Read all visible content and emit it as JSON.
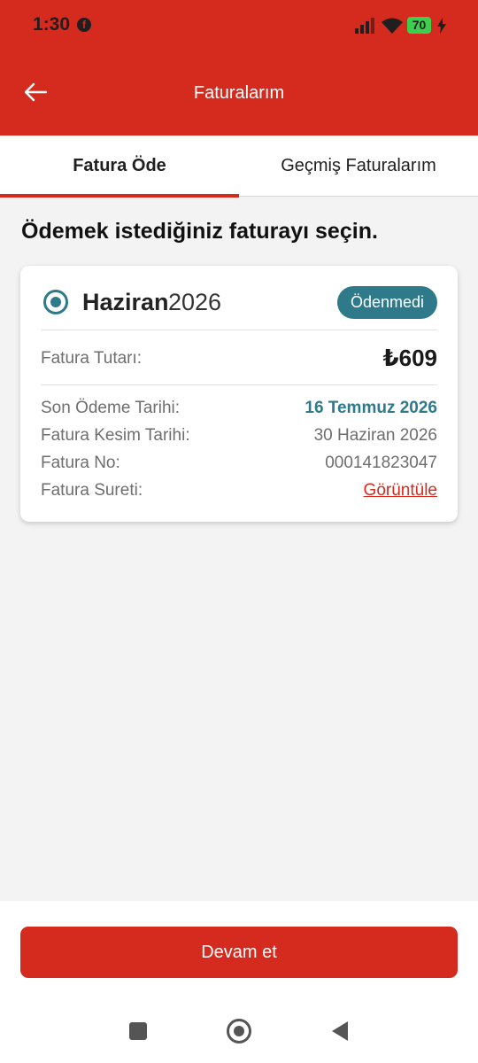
{
  "status_bar": {
    "time": "1:30",
    "battery": "70"
  },
  "header": {
    "title": "Faturalarım"
  },
  "tabs": [
    {
      "label": "Fatura Öde",
      "active": true
    },
    {
      "label": "Geçmiş Faturalarım",
      "active": false
    }
  ],
  "main": {
    "heading": "Ödemek istediğiniz faturayı seçin."
  },
  "bill": {
    "month": "Haziran",
    "year": "2026",
    "status": "Ödenmedi",
    "amount_label": "Fatura Tutarı:",
    "amount_value": "₺609",
    "rows": [
      {
        "label": "Son Ödeme Tarihi:",
        "value": "16 Temmuz 2026"
      },
      {
        "label": "Fatura Kesim Tarihi:",
        "value": "30 Haziran 2026"
      },
      {
        "label": "Fatura No:",
        "value": "000141823047"
      },
      {
        "label": "Fatura Sureti:",
        "value": "Görüntüle"
      }
    ]
  },
  "footer": {
    "continue_label": "Devam et"
  },
  "colors": {
    "brand_red": "#d52b1e",
    "accent_teal": "#2f7a8a"
  }
}
